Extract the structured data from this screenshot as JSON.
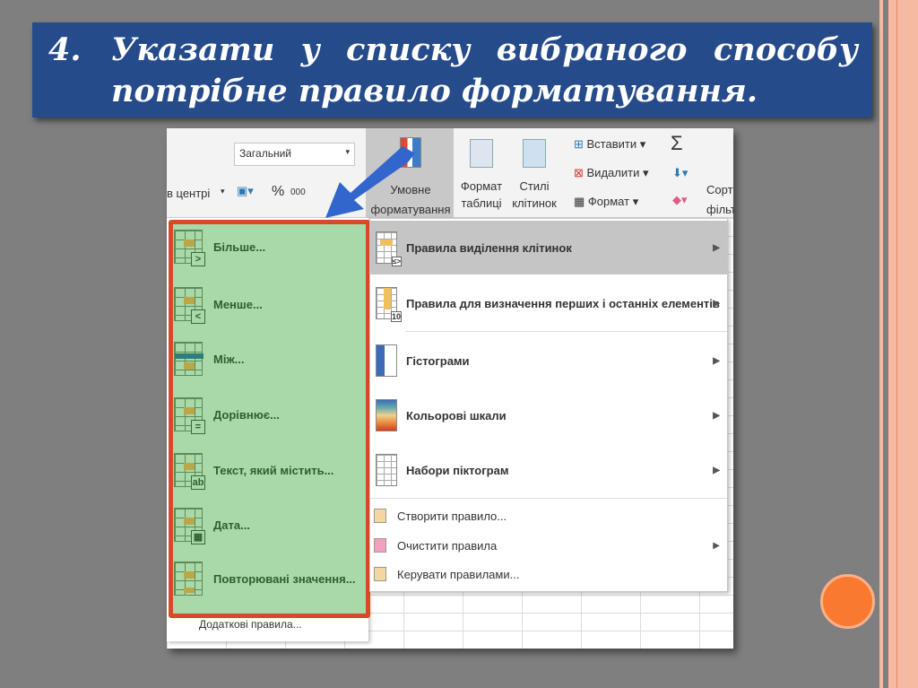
{
  "slide": {
    "number": "4.",
    "title_line1_words": [
      "Указати",
      "у",
      "списку",
      "вибраного",
      "способу"
    ],
    "title_line2": "потрібне правило форматування."
  },
  "ribbon": {
    "merge_center": "в центрі",
    "number_format": "Загальний",
    "percent": "%",
    "thousands": "000",
    "conditional_formatting": [
      "Умовне",
      "форматування"
    ],
    "format_table": [
      "Формат",
      "таблиці"
    ],
    "cell_styles": [
      "Стилі",
      "клітинок"
    ],
    "insert": "Вставити",
    "delete": "Видалити",
    "format": "Формат",
    "sum": "Σ",
    "sort_filter": [
      "Сорт",
      "фільт"
    ]
  },
  "submenu": {
    "items": [
      "Більше...",
      "Менше...",
      "Між...",
      "Дорівнює...",
      "Текст, який містить...",
      "Дата...",
      "Повторювані значення..."
    ],
    "badges": [
      ">",
      "<",
      "",
      "=",
      "ab",
      "▦",
      ""
    ],
    "more_rules": "Додаткові правила..."
  },
  "menu": {
    "items": [
      "Правила виділення клітинок",
      "Правила для визначення перших і останніх елементів",
      "Гістограми",
      "Кольорові шкали",
      "Набори піктограм"
    ],
    "badges": [
      "≤>",
      "10",
      "",
      "",
      ""
    ],
    "actions": [
      "Створити правило...",
      "Очистити правила",
      "Керувати правилами..."
    ]
  },
  "colors": {
    "title_bg": "#264b8b",
    "highlight_border": "#d84a26",
    "submenu_bg": "#a9d8a9",
    "arrow": "#3366cc",
    "circle": "#f97a2f"
  }
}
